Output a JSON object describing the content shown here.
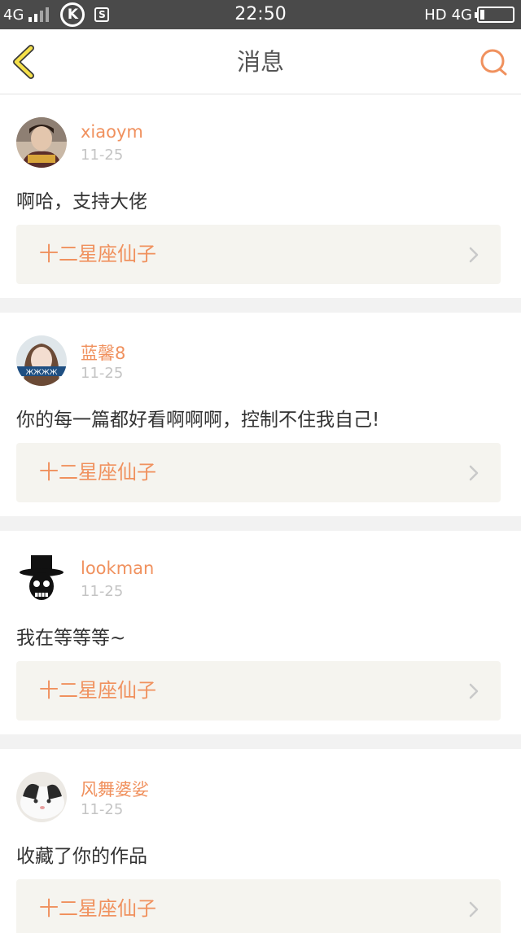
{
  "status_bar": {
    "network_left": "4G",
    "k_icon_letter": "K",
    "s_icon_letter": "S",
    "time": "22:50",
    "hd": "HD",
    "network_right": "4G"
  },
  "header": {
    "title": "消息",
    "back_icon": "chevron-left-icon",
    "search_icon": "search-icon"
  },
  "colors": {
    "accent": "#f0915e",
    "back_icon": "#f5e04a",
    "date": "#c4c4c4",
    "ref_bg": "#f5f4ef"
  },
  "messages": [
    {
      "username": "xiaoym",
      "date": "11-25",
      "content": "啊哈，支持大佬",
      "ref_title": "十二星座仙子"
    },
    {
      "username": "蓝馨8",
      "date": "11-25",
      "content": "你的每一篇都好看啊啊啊，控制不住我自己!",
      "ref_title": "十二星座仙子"
    },
    {
      "username": "lookman",
      "date": "11-25",
      "content": "我在等等等~",
      "ref_title": "十二星座仙子"
    },
    {
      "username": "风舞婆娑",
      "date": "11-25",
      "content": "收藏了你的作品",
      "ref_title": "十二星座仙子"
    }
  ]
}
